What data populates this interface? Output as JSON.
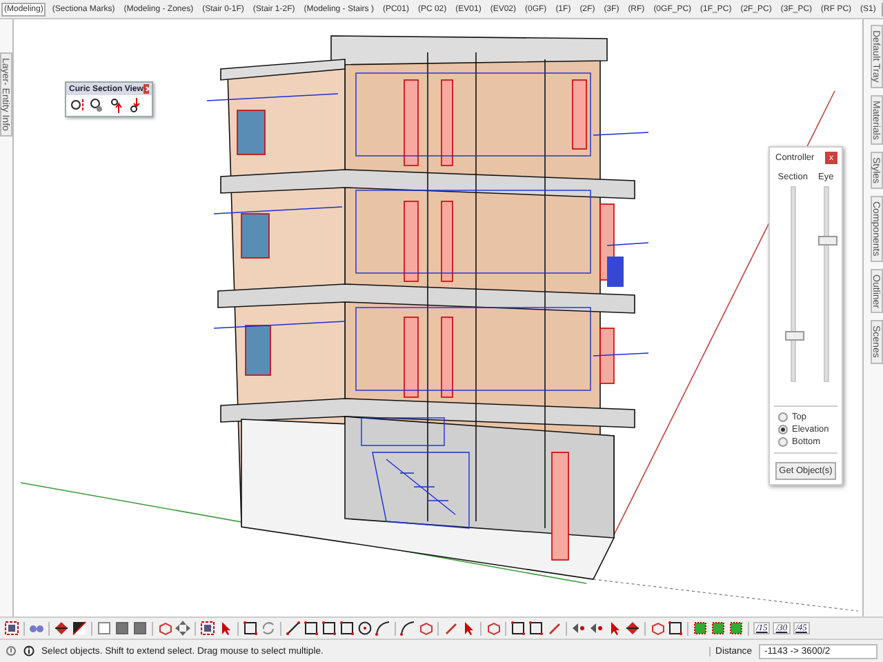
{
  "scene_tabs": [
    {
      "label": "(Modeling)",
      "selected": true
    },
    {
      "label": "(Sectiona Marks)",
      "selected": false
    },
    {
      "label": "(Modeling - Zones)",
      "selected": false
    },
    {
      "label": "(Stair 0-1F)",
      "selected": false
    },
    {
      "label": "(Stair 1-2F)",
      "selected": false
    },
    {
      "label": "(Modeling - Stairs )",
      "selected": false
    },
    {
      "label": "(PC01)",
      "selected": false
    },
    {
      "label": "(PC 02)",
      "selected": false
    },
    {
      "label": "(EV01)",
      "selected": false
    },
    {
      "label": "(EV02)",
      "selected": false
    },
    {
      "label": "(0GF)",
      "selected": false
    },
    {
      "label": "(1F)",
      "selected": false
    },
    {
      "label": "(2F)",
      "selected": false
    },
    {
      "label": "(3F)",
      "selected": false
    },
    {
      "label": "(RF)",
      "selected": false
    },
    {
      "label": "(0GF_PC)",
      "selected": false
    },
    {
      "label": "(1F_PC)",
      "selected": false
    },
    {
      "label": "(2F_PC)",
      "selected": false
    },
    {
      "label": "(3F_PC)",
      "selected": false
    },
    {
      "label": "(RF PC)",
      "selected": false
    },
    {
      "label": "(S1)",
      "selected": false
    }
  ],
  "left_tray_tabs": [
    "Layer- Entity Info"
  ],
  "right_tray_tabs": [
    "Default Tray",
    "Materials",
    "Styles",
    "Components",
    "Outliner",
    "Scenes"
  ],
  "section_palette": {
    "title": "Curic Section View"
  },
  "controller": {
    "title": "Controller",
    "close": "x",
    "sliders": [
      {
        "label": "Section",
        "level": 0.23
      },
      {
        "label": "Eye",
        "level": 0.72
      }
    ],
    "view_options": [
      {
        "label": "Top",
        "selected": false
      },
      {
        "label": "Elevation",
        "selected": true
      },
      {
        "label": "Bottom",
        "selected": false
      }
    ],
    "button": "Get Object(s)"
  },
  "scale_buttons": [
    "/15",
    "/30",
    "/45"
  ],
  "status_bar": {
    "message": "Select objects. Shift to extend select. Drag mouse to select multiple.",
    "measurement_label": "Distance",
    "measurement_value": "-1143 -> 3600/2"
  }
}
